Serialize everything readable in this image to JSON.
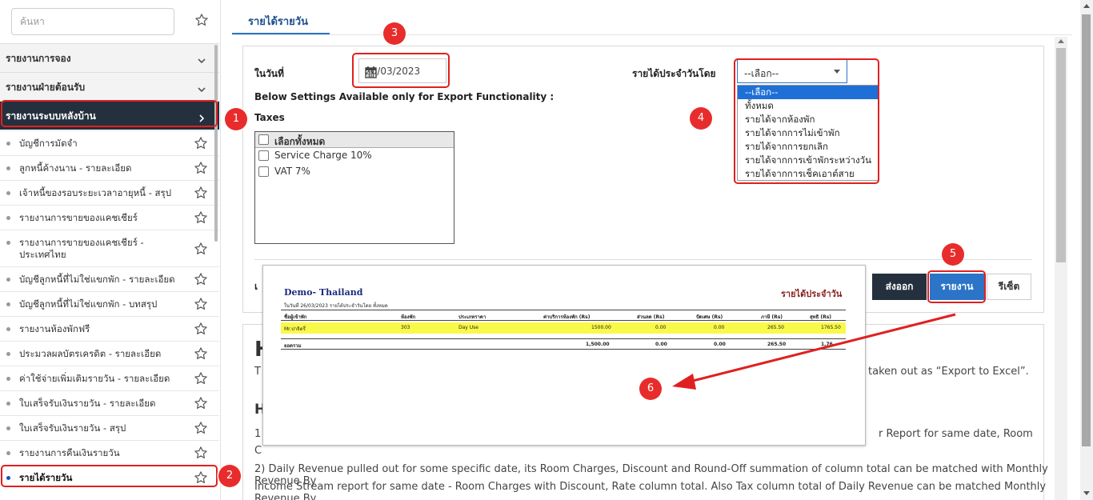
{
  "sidebar": {
    "search_placeholder": "ค้นหา",
    "sections": [
      {
        "label": "รายงานการจอง"
      },
      {
        "label": "รายงานฝ่ายต้อนรับ"
      },
      {
        "label": "รายงานระบบหลังบ้าน"
      }
    ],
    "items": [
      {
        "label": "บัญชีการมัดจำ"
      },
      {
        "label": "ลูกหนี้ค้างนาน - รายละเอียด"
      },
      {
        "label": "เจ้าหนี้ของรอบระยะเวลาอายุหนี้ - สรุป"
      },
      {
        "label": "รายงานการขายของแคชเชียร์"
      },
      {
        "label": "รายงานการขายของแคชเชียร์ - ประเทศไทย"
      },
      {
        "label": "บัญชีลูกหนี้ที่ไม่ใช่แขกพัก - รายละเอียด"
      },
      {
        "label": "บัญชีลูกหนี้ที่ไม่ใช่แขกพัก - บทสรุป"
      },
      {
        "label": "รายงานห้องพักฟรี"
      },
      {
        "label": "ประมวลผลบัตรเครดิต - รายละเอียด"
      },
      {
        "label": "ค่าใช้จ่ายเพิ่มเติมรายวัน - รายละเอียด"
      },
      {
        "label": "ใบเสร็จรับเงินรายวัน - รายละเอียด"
      },
      {
        "label": "ใบเสร็จรับเงินรายวัน - สรุป"
      },
      {
        "label": "รายงานการคืนเงินรายวัน"
      },
      {
        "label": "รายได้รายวัน"
      }
    ]
  },
  "main": {
    "tab_label": "รายได้รายวัน",
    "date_label": "ในวันที่",
    "date_value": "20/03/2023",
    "revenue_by_label": "รายได้ประจำวันโดย",
    "select_value": "--เลือก--",
    "dropdown_options": [
      "--เลือก--",
      "ทั้งหมด",
      "รายได้จากห้องพัก",
      "รายได้จากการไม่เข้าพัก",
      "รายได้จากการยกเลิก",
      "รายได้จากการเข้าพักระหว่างวัน",
      "รายได้จากการเช็คเอาต์สาย"
    ],
    "export_note": "Below Settings Available only for Export Functionality :",
    "taxes_label": "Taxes",
    "taxes": {
      "select_all": "เลือกทั้งหมด",
      "options": [
        "Service Charge 10%",
        "VAT 7%"
      ]
    },
    "buttons": {
      "export": "ส่งออก",
      "report": "รายงาน",
      "reset": "รีเซ็ต"
    },
    "cut_label": "เ"
  },
  "help": {
    "h1": "H",
    "p1_left": "T",
    "p1_right": "taken out as “Export to Excel”.",
    "h2": "H",
    "l1_left": "1",
    "l1_right": "r Report for same date, Room",
    "l1_c": "C",
    "l2": "2) Daily Revenue pulled out for some specific date, its Room Charges, Discount and Round-Off summation of column total can be matched with Monthly Revenue By",
    "l3": "Income Stream report for same date - Room Charges with Discount, Rate column total. Also Tax column total of Daily Revenue can be matched Monthly Revenue By"
  },
  "preview": {
    "title": "Demo- Thailand",
    "report_title": "รายได้ประจำวัน",
    "subtitle": "ในวันที่ 26/03/2023   รายได้ประจำวันโดย ทั้งหมด",
    "headers": [
      "ชื่อผู้เข้าพัก",
      "ห้องพัก",
      "ประเภทราคา",
      "ค่าบริการห้องพัก (Rs)",
      "ส่วนลด (Rs)",
      "ปัดเศษ (Rs)",
      "ภาษี (Rs)",
      "สุทธิ (Rs)"
    ],
    "row": [
      "Mr.ปาจิตรี่",
      "303",
      "Day Use",
      "1500.00",
      "0.00",
      "0.00",
      "265.50",
      "1765.50"
    ],
    "total_label": "ยอดรวม",
    "totals": [
      "1,500.00",
      "0.00",
      "0.00",
      "265.50",
      "1,76"
    ]
  },
  "annotations": {
    "b1": "1",
    "b2": "2",
    "b3": "3",
    "b4": "4",
    "b5": "5",
    "b6": "6",
    "color": "#e02020"
  }
}
